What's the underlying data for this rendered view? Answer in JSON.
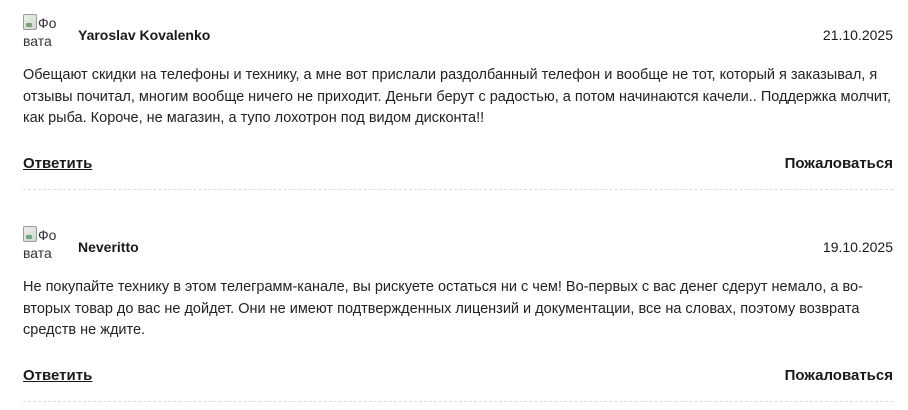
{
  "reviews": [
    {
      "avatar_alt": "Фо вата",
      "author": "Yaroslav Kovalenko",
      "date": "21.10.2025",
      "text": "Обещают скидки на телефоны и технику, а мне вот прислали раздолбанный телефон и вообще не тот, который я заказывал, я отзывы почитал, многим вообще ничего не приходит. Деньги берут с радостью, а потом начинаются качели.. Поддержка молчит, как рыба. Короче, не магазин, а тупо лохотрон под видом дисконта!!",
      "reply_label": "Ответить",
      "complain_label": "Пожаловаться"
    },
    {
      "avatar_alt": "Фо вата",
      "author": "Neveritto",
      "date": "19.10.2025",
      "text": "Не покупайте технику в этом телеграмм-канале, вы рискуете остаться ни с чем! Во-первых с вас денег сдерут немало, а во-вторых товар до вас не дойдет. Они не имеют подтвержденных лицензий и документации, все на словах, поэтому возврата средств не ждите.",
      "reply_label": "Ответить",
      "complain_label": "Пожаловаться"
    }
  ]
}
